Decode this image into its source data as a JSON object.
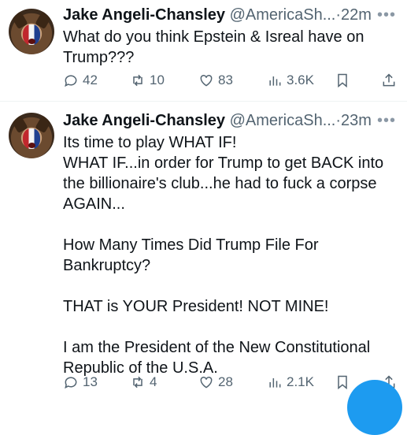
{
  "tweets": [
    {
      "name": "Jake Angeli-Chansley",
      "handle": "@AmericaSh...",
      "dot": "·",
      "time": "22m",
      "lines": [
        "What do you think Epstein & Isreal have on",
        "Trump???"
      ],
      "stats": {
        "replies": "42",
        "reposts": "10",
        "likes": "83",
        "views": "3.6K"
      }
    },
    {
      "name": "Jake Angeli-Chansley",
      "handle": "@AmericaSh...",
      "dot": "·",
      "time": "23m",
      "lines": [
        "Its time to play WHAT IF!",
        "WHAT IF...in order for Trump to get BACK into",
        "the billionaire's club...he had to fuck a corpse",
        "AGAIN...",
        "",
        "How Many Times Did Trump File For",
        "Bankruptcy?",
        "",
        "THAT is YOUR President! NOT MINE!",
        "",
        "I am the President of the New Constitutional",
        "Republic of the U.S.A."
      ],
      "stats": {
        "replies": "13",
        "reposts": "4",
        "likes": "28",
        "views": "2.1K"
      }
    }
  ],
  "icons": {
    "more": "more-icon",
    "reply": "reply-icon",
    "repost": "repost-icon",
    "like": "like-icon",
    "views": "views-icon",
    "bookmark": "bookmark-icon",
    "share": "share-icon"
  },
  "colors": {
    "text": "#0f1419",
    "secondary": "#536471",
    "accent": "#1d9bf0"
  }
}
